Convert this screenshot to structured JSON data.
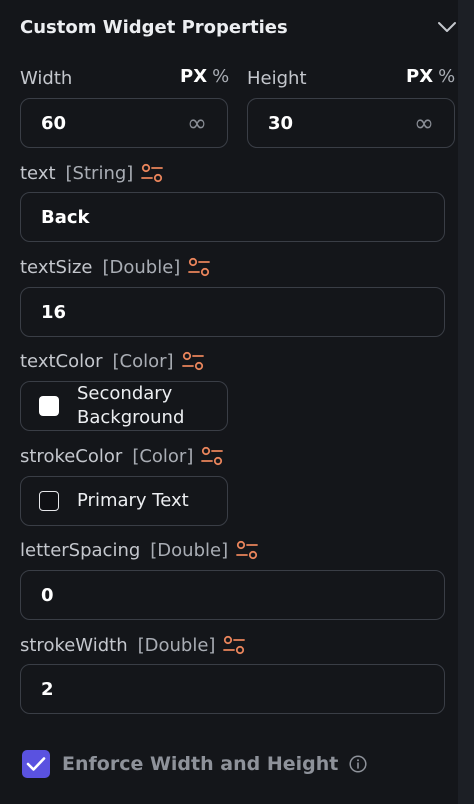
{
  "header": {
    "title": "Custom Widget Properties",
    "chevron_icon": "chevron-down-icon"
  },
  "dimensions": {
    "width": {
      "label": "Width",
      "unit_px": "PX",
      "unit_pct": "%",
      "value": "60",
      "infinity": "∞"
    },
    "height": {
      "label": "Height",
      "unit_px": "PX",
      "unit_pct": "%",
      "value": "30",
      "infinity": "∞"
    }
  },
  "params": {
    "text": {
      "name": "text",
      "type": "[String]",
      "value": "Back"
    },
    "textSize": {
      "name": "textSize",
      "type": "[Double]",
      "value": "16"
    },
    "textColor": {
      "name": "textColor",
      "type": "[Color]",
      "value": "Secondary Background",
      "value_line1": "Secondary",
      "value_line2": "Background",
      "swatch": "#ffffff"
    },
    "strokeColor": {
      "name": "strokeColor",
      "type": "[Color]",
      "value": "Primary Text",
      "swatch": "#0f1014"
    },
    "letterSpacing": {
      "name": "letterSpacing",
      "type": "[Double]",
      "value": "0"
    },
    "strokeWidth": {
      "name": "strokeWidth",
      "type": "[Double]",
      "value": "2"
    }
  },
  "enforce": {
    "label": "Enforce Width and Height",
    "checked": true,
    "info_icon": "info-icon"
  },
  "colors": {
    "accent": "#5a52e0",
    "variable_icon": "#e8845b",
    "background": "#14161a",
    "border": "#3a3e46"
  }
}
